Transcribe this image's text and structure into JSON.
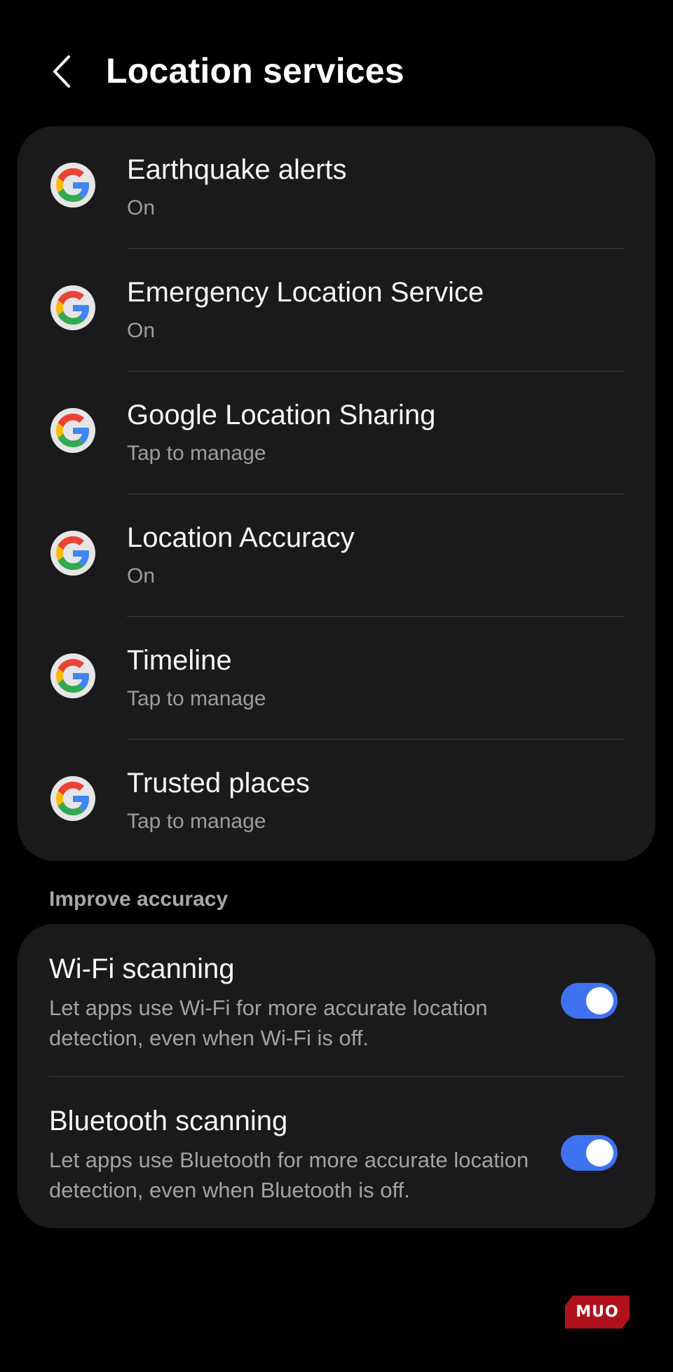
{
  "header": {
    "title": "Location services",
    "back_icon": "chevron-left-icon"
  },
  "google_services": {
    "items": [
      {
        "title": "Earthquake alerts",
        "subtitle": "On",
        "icon": "google-g-icon"
      },
      {
        "title": "Emergency Location Service",
        "subtitle": "On",
        "icon": "google-g-icon"
      },
      {
        "title": "Google Location Sharing",
        "subtitle": "Tap to manage",
        "icon": "google-g-icon"
      },
      {
        "title": "Location Accuracy",
        "subtitle": "On",
        "icon": "google-g-icon"
      },
      {
        "title": "Timeline",
        "subtitle": "Tap to manage",
        "icon": "google-g-icon"
      },
      {
        "title": "Trusted places",
        "subtitle": "Tap to manage",
        "icon": "google-g-icon"
      }
    ]
  },
  "improve_accuracy": {
    "section_label": "Improve accuracy",
    "items": [
      {
        "title": "Wi-Fi scanning",
        "description": "Let apps use Wi-Fi for more accurate location detection, even when Wi-Fi is off.",
        "enabled": true
      },
      {
        "title": "Bluetooth scanning",
        "description": "Let apps use Bluetooth for more accurate location detection, even when Bluetooth is off.",
        "enabled": true
      }
    ]
  },
  "watermark": {
    "text": "MUO"
  },
  "colors": {
    "background": "#000000",
    "card": "#1a1a1c",
    "toggle_on": "#3f72f0",
    "watermark": "#b0121d"
  }
}
